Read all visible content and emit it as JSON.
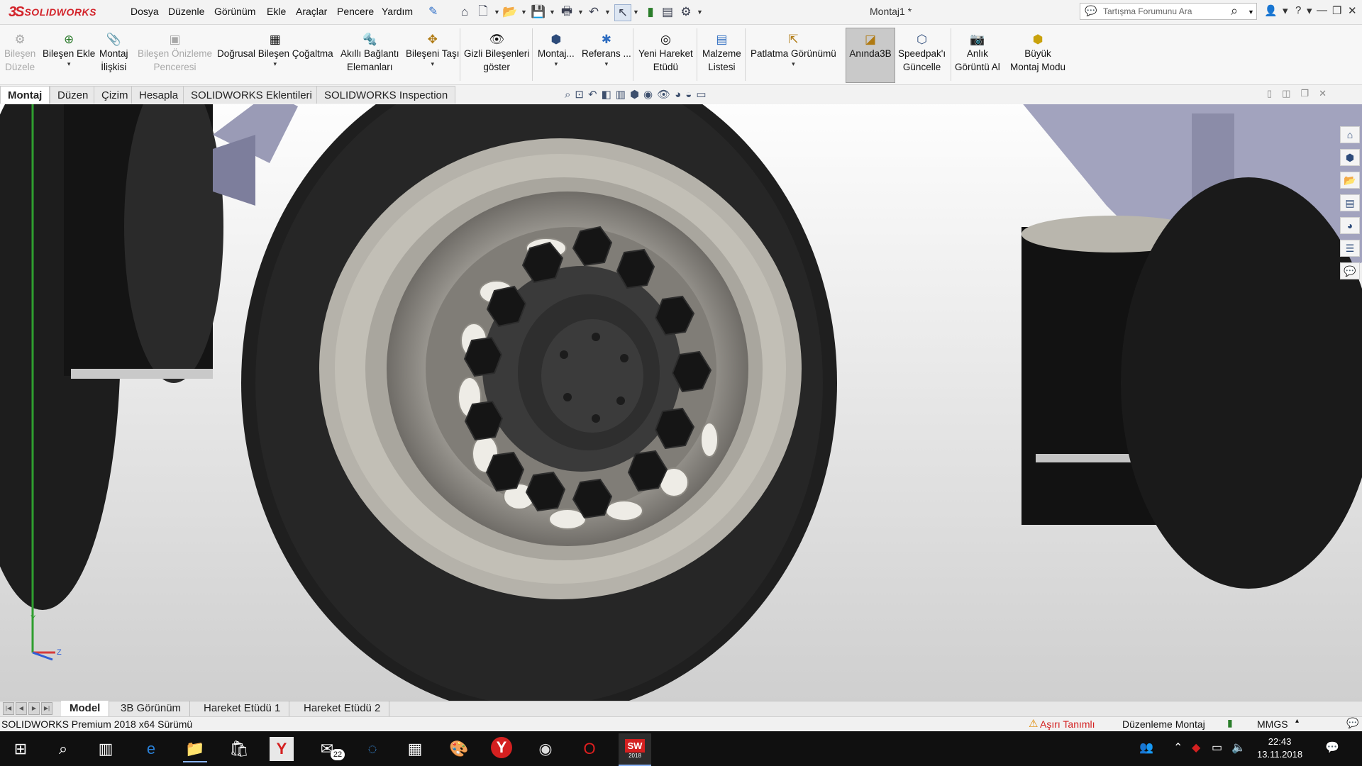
{
  "app": {
    "logo_prefix": "3S",
    "logo_text": "SOLIDWORKS",
    "doc_title": "Montaj1 *"
  },
  "menu": [
    "Dosya",
    "Düzenle",
    "Görünüm",
    "Ekle",
    "Araçlar",
    "Pencere",
    "Yardım"
  ],
  "search": {
    "placeholder": "Tartışma Forumunu Ara"
  },
  "commands": [
    {
      "line1": "Bileşen",
      "line2": "Düzele",
      "icon": "edit-component-icon",
      "disabled": true
    },
    {
      "line1": "Bileşen Ekle",
      "line2": "",
      "icon": "insert-component-icon"
    },
    {
      "line1": "Montaj",
      "line2": "İlişkisi",
      "icon": "mate-icon"
    },
    {
      "line1": "Bileşen Önizleme",
      "line2": "Penceresi",
      "icon": "preview-window-icon",
      "disabled": true
    },
    {
      "line1": "Doğrusal Bileşen Çoğaltma",
      "line2": "",
      "icon": "linear-pattern-icon"
    },
    {
      "line1": "Akıllı Bağlantı",
      "line2": "Elemanları",
      "icon": "smart-fasteners-icon"
    },
    {
      "line1": "Bileşeni Taşı",
      "line2": "",
      "icon": "move-component-icon"
    },
    {
      "line1": "Gizli Bileşenleri",
      "line2": "göster",
      "icon": "show-hidden-icon"
    },
    {
      "line1": "Montaj...",
      "line2": "",
      "icon": "assembly-features-icon"
    },
    {
      "line1": "Referans ...",
      "line2": "",
      "icon": "reference-geometry-icon"
    },
    {
      "line1": "Yeni Hareket",
      "line2": "Etüdü",
      "icon": "motion-study-icon"
    },
    {
      "line1": "Malzeme",
      "line2": "Listesi",
      "icon": "bom-icon"
    },
    {
      "line1": "Patlatma Görünümü",
      "line2": "",
      "icon": "exploded-view-icon"
    },
    {
      "line1": "Anında3B",
      "line2": "",
      "icon": "instant3d-icon"
    },
    {
      "line1": "Speedpak'ı",
      "line2": "Güncelle",
      "icon": "speedpak-icon"
    },
    {
      "line1": "Anlık",
      "line2": "Görüntü Al",
      "icon": "snapshot-icon"
    },
    {
      "line1": "Büyük",
      "line2": "Montaj Modu",
      "icon": "large-assembly-icon"
    }
  ],
  "tabs": [
    "Montaj",
    "Düzen",
    "Çizim",
    "Hesapla",
    "SOLIDWORKS Eklentileri",
    "SOLIDWORKS Inspection"
  ],
  "bottom_tabs": [
    "Model",
    "3B Görünüm",
    "Hareket Etüdü 1",
    "Hareket Etüdü 2"
  ],
  "status": {
    "left": "SOLIDWORKS Premium 2018 x64 Sürümü",
    "overdefined": "Aşırı Tanımlı",
    "mode": "Düzenleme Montaj",
    "units": "MMGS"
  },
  "triad": {
    "y": "Y",
    "z": "Z"
  },
  "taskbar": {
    "mail_badge": "22",
    "time": "22:43",
    "date": "13.11.2018",
    "sw_badge": "SW",
    "sw_year": "2018"
  }
}
